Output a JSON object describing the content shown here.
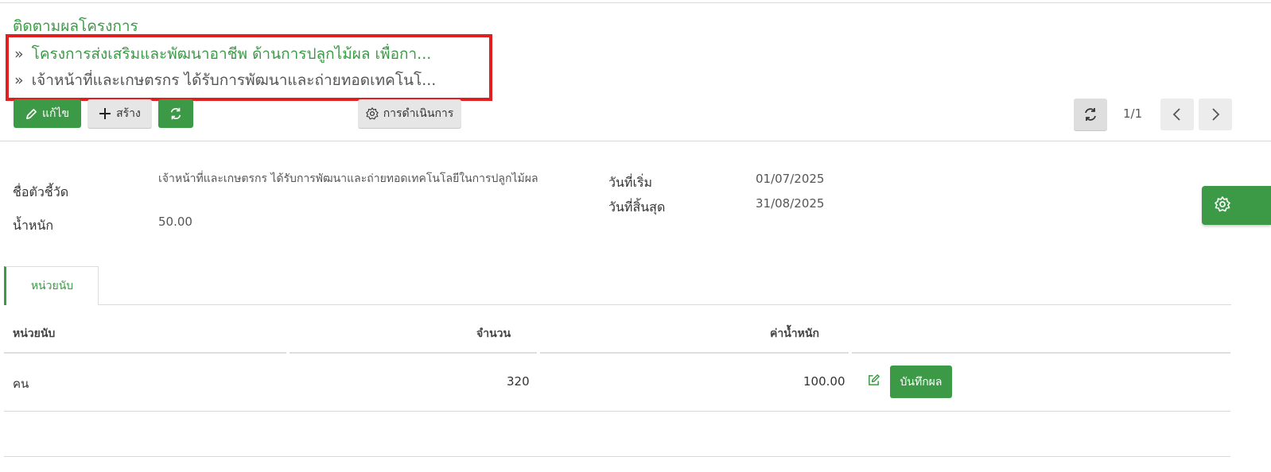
{
  "breadcrumb": {
    "root": "ติดตามผลโครงการ",
    "items": [
      "โครงการส่งเสริมและพัฒนาอาชีพ ด้านการปลูกไม้ผล เพื่อกา...",
      "เจ้าหน้าที่และเกษตรกร ได้รับการพัฒนาและถ่ายทอดเทคโนโ..."
    ]
  },
  "toolbar": {
    "edit_label": "แก้ไข",
    "create_label": "สร้าง",
    "action_label": "การดำเนินการ",
    "pager": "1/1"
  },
  "form": {
    "indicator_label": "ชื่อตัวชี้วัด",
    "indicator_value": "เจ้าหน้าที่และเกษตรกร ได้รับการพัฒนาและถ่ายทอดเทคโนโลยีในการปลูกไม้ผล",
    "weight_label": "น้ำหนัก",
    "weight_value": "50.00",
    "start_label": "วันที่เริ่ม",
    "start_value": "01/07/2025",
    "end_label": "วันที่สิ้นสุด",
    "end_value": "31/08/2025"
  },
  "tabs": [
    {
      "label": "หน่วยนับ"
    }
  ],
  "table": {
    "headers": [
      "หน่วยนับ",
      "จำนวน",
      "ค่าน้ำหนัก"
    ],
    "rows": [
      {
        "unit": "คน",
        "amount": "320",
        "weight": "100.00",
        "action_label": "บันทึกผล"
      }
    ]
  },
  "colors": {
    "accent": "#3c9a47",
    "highlight": "#e02020"
  }
}
